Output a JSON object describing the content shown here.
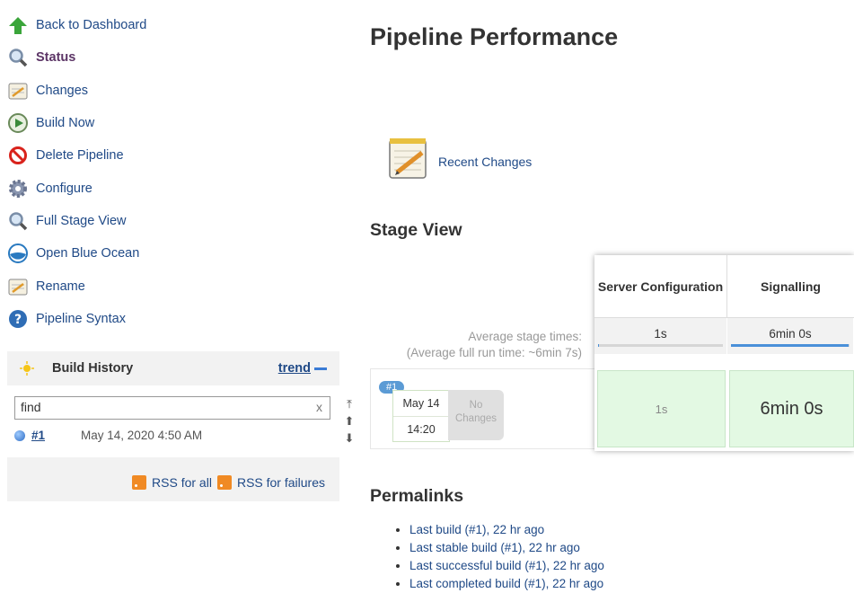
{
  "sidebar": {
    "items": [
      {
        "label": "Back to Dashboard",
        "icon": "up-arrow-icon"
      },
      {
        "label": "Status",
        "icon": "magnifier-icon"
      },
      {
        "label": "Changes",
        "icon": "notepad-icon"
      },
      {
        "label": "Build Now",
        "icon": "clock-play-icon"
      },
      {
        "label": "Delete Pipeline",
        "icon": "no-entry-icon"
      },
      {
        "label": "Configure",
        "icon": "gear-icon"
      },
      {
        "label": "Full Stage View",
        "icon": "magnifier-icon"
      },
      {
        "label": "Open Blue Ocean",
        "icon": "blue-ocean-icon"
      },
      {
        "label": "Rename",
        "icon": "notepad-icon"
      },
      {
        "label": "Pipeline Syntax",
        "icon": "help-icon"
      }
    ]
  },
  "build_history": {
    "title": "Build History",
    "trend": "trend",
    "search_value": "find",
    "clear": "x",
    "builds": [
      {
        "number": "#1",
        "date": "May 14, 2020 4:50 AM"
      }
    ],
    "rss_all": "RSS for all",
    "rss_failures": "RSS for failures"
  },
  "main": {
    "title": "Pipeline Performance",
    "recent_changes": "Recent Changes",
    "stage_view_title": "Stage View",
    "avg_stage_times": "Average stage times:",
    "avg_full_run": "(Average full run time: ~6min 7s)",
    "build_badge": "#1",
    "build_date": "May 14",
    "build_time": "14:20",
    "no_changes": "No Changes",
    "stages": [
      {
        "name": "Server Configuration",
        "avg": "1s",
        "avg_fraction": 0.01,
        "duration": "1s"
      },
      {
        "name": "Signalling",
        "avg": "6min 0s",
        "avg_fraction": 0.99,
        "duration": "6min 0s"
      }
    ],
    "permalinks_title": "Permalinks",
    "permalinks": [
      "Last build (#1), 22 hr ago",
      "Last stable build (#1), 22 hr ago",
      "Last successful build (#1), 22 hr ago",
      "Last completed build (#1), 22 hr ago"
    ]
  }
}
